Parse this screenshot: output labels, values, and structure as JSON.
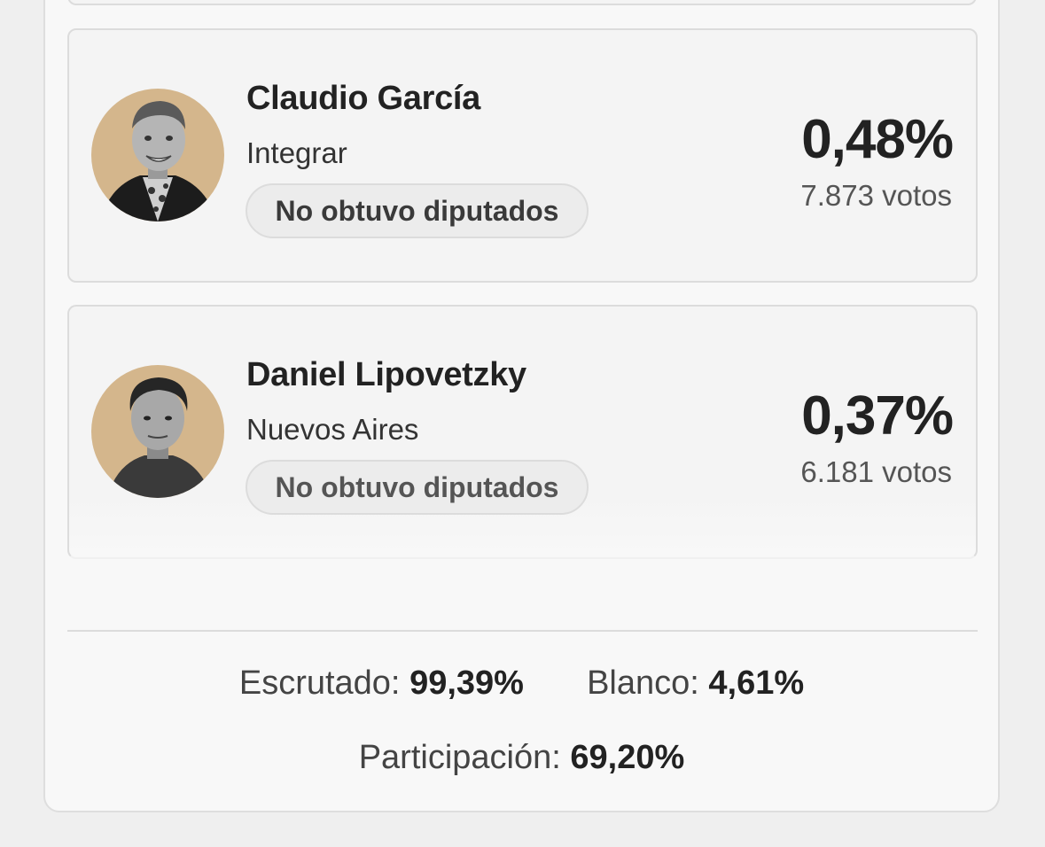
{
  "candidates": [
    {
      "name": "Claudio García",
      "party": "Integrar",
      "status": "No obtuvo diputados",
      "percent": "0,48%",
      "votes": "7.873 votos"
    },
    {
      "name": "Daniel Lipovetzky",
      "party": "Nuevos Aires",
      "status": "No obtuvo diputados",
      "percent": "0,37%",
      "votes": "6.181 votos"
    }
  ],
  "summary": {
    "scrutinized_label": "Escrutado:",
    "scrutinized_value": "99,39%",
    "blank_label": "Blanco:",
    "blank_value": "4,61%",
    "participation_label": "Participación:",
    "participation_value": "69,20%"
  },
  "colors": {
    "avatar_background": "#d4b68c",
    "card_background": "#f4f4f4",
    "page_background": "#efefef"
  }
}
